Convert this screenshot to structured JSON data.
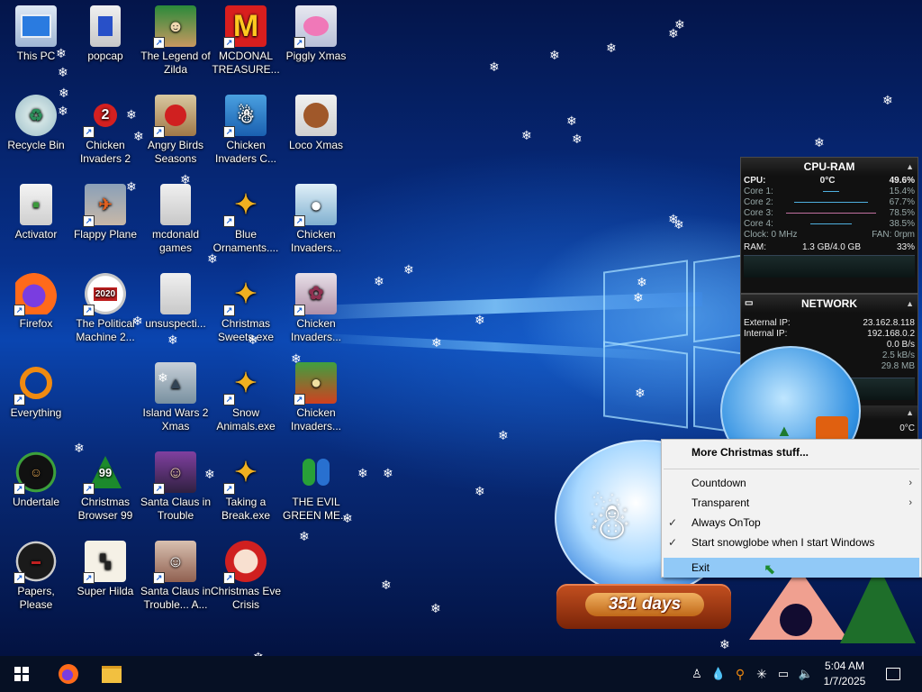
{
  "desktop_icons": {
    "this_pc": "This PC",
    "popcap": "popcap",
    "zelda": "The Legend of Zilda",
    "mcdonal": "MCDONAL TREASURE...",
    "piggly": "Piggly Xmas",
    "recycle": "Recycle Bin",
    "ci2": "Chicken Invaders 2",
    "angry": "Angry Birds Seasons",
    "cic": "Chicken Invaders C...",
    "loco": "Loco Xmas",
    "activator": "Activator",
    "flappy": "Flappy Plane",
    "mcgames": "mcdonald games",
    "blue_orn": "Blue Ornaments....",
    "ci_a": "Chicken Invaders...",
    "firefox": "Firefox",
    "political": "The Political Machine 2...",
    "unsuspect": "unsuspecti...",
    "sweets": "Christmas Sweets.exe",
    "ci_b": "Chicken Invaders...",
    "everything": "Everything",
    "island": "Island Wars 2 Xmas",
    "snow_animals": "Snow Animals.exe",
    "ci_c": "Chicken Invaders...",
    "undertale": "Undertale",
    "browser99": "Christmas Browser 99",
    "santa_trouble": "Santa Claus in Trouble",
    "break": "Taking a Break.exe",
    "evil": "THE EVIL GREEN ME...",
    "papers": "Papers, Please",
    "hilda": "Super Hilda",
    "santa_trouble2": "Santa Claus in Trouble... A...",
    "eve_crisis": "Christmas Eve Crisis",
    "badge_2020": "2020",
    "badge_99": "99"
  },
  "cpu_gadget": {
    "title": "CPU-RAM",
    "cpu_label": "CPU:",
    "cpu_temp": "0°C",
    "cpu_pct": "49.6%",
    "cores": [
      {
        "label": "Core 1:",
        "value": "15.4%"
      },
      {
        "label": "Core 2:",
        "value": "67.7%"
      },
      {
        "label": "Core 3:",
        "value": "78.5%"
      },
      {
        "label": "Core 4:",
        "value": "38.5%"
      }
    ],
    "clock": "Clock: 0 MHz",
    "fan": "FAN: 0rpm",
    "ram_label": "RAM:",
    "ram_used": "1.3 GB/4.0 GB",
    "ram_pct": "33%"
  },
  "net_gadget": {
    "title": "NETWORK",
    "external_label": "External IP:",
    "external_ip": "23.162.8.118",
    "internal_label": "Internal IP:",
    "internal_ip": "192.168.0.2",
    "rate1": "0.0 B/s",
    "rate2": "2.5 kB/s",
    "total": "29.8 MB",
    "temp": "0°C"
  },
  "snowglobe": {
    "days": "351 days"
  },
  "context_menu": {
    "more": "More Christmas stuff...",
    "countdown": "Countdown",
    "transparent": "Transparent",
    "always_on_top": "Always OnTop",
    "start_with_windows": "Start snowglobe when I start Windows",
    "exit": "Exit",
    "checkmark": "✓",
    "submenu_arrow": "›"
  },
  "taskbar": {
    "time": "5:04 AM",
    "date": "1/7/2025"
  },
  "colors": {
    "desktop_blue": "#0a45b0",
    "taskbar": "#061024",
    "menu_highlight": "#91c9f7"
  }
}
